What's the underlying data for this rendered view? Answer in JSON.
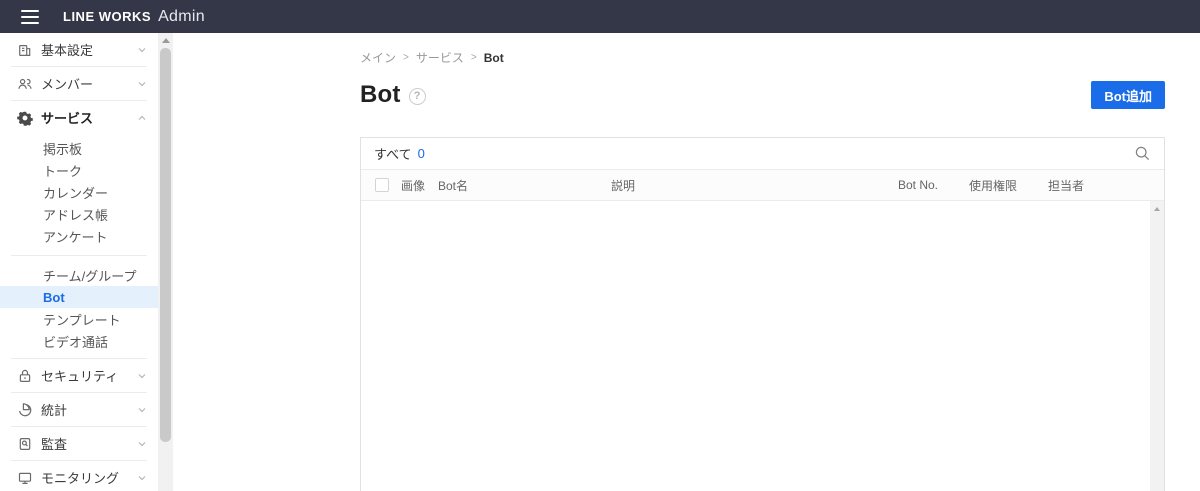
{
  "topbar": {
    "brand": "LINE WORKS",
    "product": "Admin"
  },
  "breadcrumb": {
    "items": [
      "メイン",
      "サービス",
      "Bot"
    ],
    "separator": ">"
  },
  "page": {
    "title": "Bot",
    "help": "?",
    "add_button_label": "Bot追加"
  },
  "sidebar": {
    "items": [
      {
        "label": "基本設定",
        "icon": "building-icon",
        "state": "collapsed"
      },
      {
        "label": "メンバー",
        "icon": "members-icon",
        "state": "collapsed"
      },
      {
        "label": "サービス",
        "icon": "gear-icon",
        "state": "expanded"
      },
      {
        "label": "掲示板"
      },
      {
        "label": "トーク"
      },
      {
        "label": "カレンダー"
      },
      {
        "label": "アドレス帳"
      },
      {
        "label": "アンケート"
      },
      {
        "label": "チーム/グループ"
      },
      {
        "label": "Bot",
        "selected": true
      },
      {
        "label": "テンプレート"
      },
      {
        "label": "ビデオ通話"
      },
      {
        "label": "セキュリティ",
        "icon": "lock-icon",
        "state": "collapsed"
      },
      {
        "label": "統計",
        "icon": "pie-chart-icon",
        "state": "collapsed"
      },
      {
        "label": "監査",
        "icon": "audit-search-icon",
        "state": "collapsed"
      },
      {
        "label": "モニタリング",
        "icon": "monitor-icon",
        "state": "collapsed"
      }
    ]
  },
  "table": {
    "filter_tab": "すべて",
    "filter_count": "0",
    "columns": [
      "画像",
      "Bot名",
      "説明",
      "Bot No.",
      "使用権限",
      "担当者"
    ],
    "rows": []
  },
  "colors": {
    "topbar_bg": "#343747",
    "accent_blue": "#1a6ce8",
    "selected_item_bg": "#e4f0fc"
  }
}
